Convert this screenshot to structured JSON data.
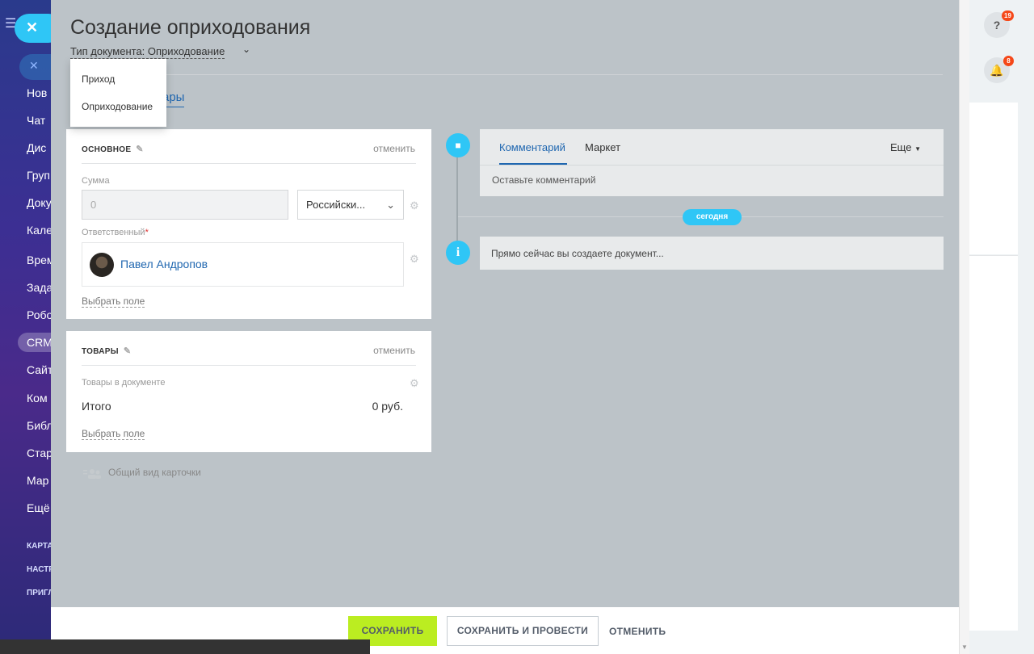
{
  "sidebar": {
    "items": [
      "Нов",
      "Чат",
      "Дис",
      "Груп",
      "Доку",
      "Кале",
      "Врем",
      "Зада",
      "Робо",
      "CRM",
      "Сайт",
      "Ком",
      "Библ",
      "Стар",
      "Мар",
      "Ещё"
    ],
    "small_items": [
      "КАРТА",
      "НАСТР",
      "ПРИГЛ"
    ]
  },
  "header": {
    "title": "Создание оприходования",
    "doc_type": "Тип документа: Оприходование",
    "tab_label": "ары"
  },
  "doc_type_menu": {
    "items": [
      "Приход",
      "Оприходование"
    ]
  },
  "main_card": {
    "title": "ОСНОВНОЕ",
    "cancel": "отменить",
    "sum_label": "Сумма",
    "sum_value": "0",
    "currency": "Российски...",
    "responsible_label": "Ответственный",
    "required_mark": "*",
    "responsible_name": "Павел Андропов",
    "choose_field": "Выбрать поле"
  },
  "goods_card": {
    "title": "ТОВАРЫ",
    "cancel": "отменить",
    "goods_label": "Товары в документе",
    "total_label": "Итого",
    "total_value": "0 руб.",
    "choose_field": "Выбрать поле"
  },
  "card_view_link": "Общий вид карточки",
  "timeline": {
    "tabs": [
      "Комментарий",
      "Маркет"
    ],
    "more": "Еще",
    "comment_placeholder": "Оставьте комментарий",
    "today": "сегодня",
    "info_text": "Прямо сейчас вы создаете документ..."
  },
  "footer": {
    "save": "СОХРАНИТЬ",
    "save_and_post": "СОХРАНИТЬ И ПРОВЕСТИ",
    "cancel": "ОТМЕНИТЬ"
  },
  "right_rail": {
    "help_badge": "19",
    "notify_badge": "8"
  },
  "colors": {
    "accent_blue": "#2fc6f6",
    "link_blue": "#2067b0",
    "save_green": "#bbed21",
    "badge_red": "#f54819"
  }
}
